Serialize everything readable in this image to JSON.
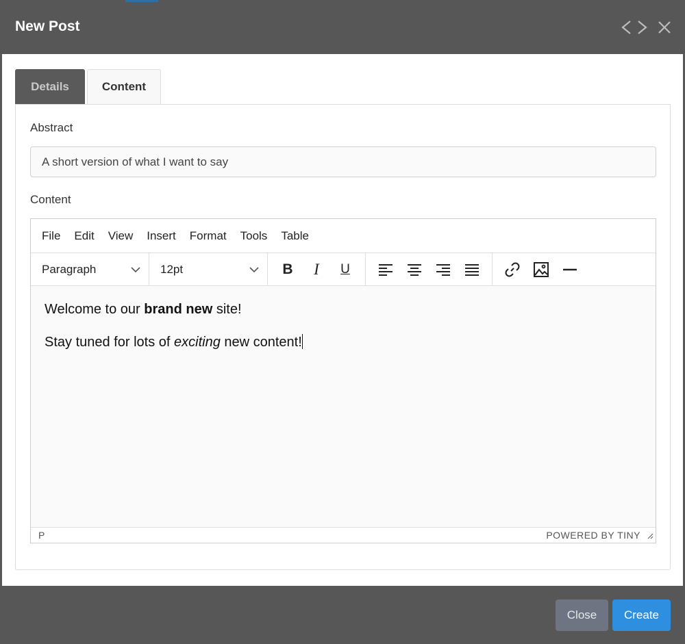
{
  "header": {
    "title": "New Post"
  },
  "tabs": [
    {
      "label": "Details"
    },
    {
      "label": "Content"
    }
  ],
  "form": {
    "abstract_label": "Abstract",
    "abstract_value": "A short version of what I want to say",
    "content_label": "Content"
  },
  "editor": {
    "menu": [
      "File",
      "Edit",
      "View",
      "Insert",
      "Format",
      "Tools",
      "Table"
    ],
    "block_format": "Paragraph",
    "font_size": "12pt",
    "line1": {
      "before": "Welcome to our ",
      "bold": "brand new",
      "after": " site!"
    },
    "line2": {
      "before": "Stay tuned for lots of ",
      "italic": "exciting",
      "after": " new content!"
    },
    "status_path": "P",
    "powered_by": "POWERED BY TINY"
  },
  "footer": {
    "close_label": "Close",
    "create_label": "Create"
  },
  "colors": {
    "header_bg": "#575757",
    "create_button": "#2e8fe0",
    "close_button": "#6e7482"
  },
  "icons": [
    "code-icon",
    "close-icon",
    "chevron-down-icon",
    "bold-icon",
    "italic-icon",
    "underline-icon",
    "align-left-icon",
    "align-center-icon",
    "align-right-icon",
    "align-justify-icon",
    "link-icon",
    "image-icon",
    "horizontal-rule-icon",
    "resize-handle-icon"
  ]
}
